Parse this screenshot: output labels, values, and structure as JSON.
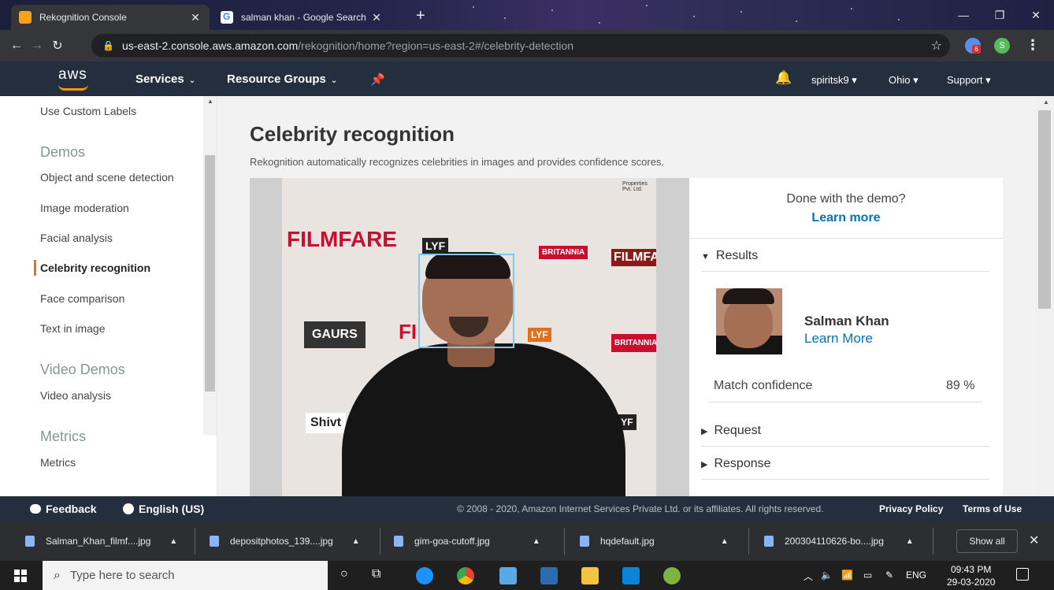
{
  "browser": {
    "tabs": [
      {
        "title": "Rekognition Console",
        "active": true
      },
      {
        "title": "salman khan - Google Search",
        "active": false
      }
    ],
    "new_tab": "+",
    "address": {
      "host": "us-east-2.console.aws.amazon.com",
      "path": "/rekognition/home?region=us-east-2#/celebrity-detection"
    },
    "ext_badge": "6",
    "profile_initial": "S",
    "window_controls": {
      "minimize": "—",
      "maximize": "❐",
      "close": "✕"
    }
  },
  "aws_nav": {
    "logo": "aws",
    "services": "Services",
    "resource_groups": "Resource Groups",
    "user": "spiritsk9",
    "region": "Ohio",
    "support": "Support"
  },
  "sidebar": {
    "top_item": "Use Custom Labels",
    "sections": [
      {
        "heading": "Demos",
        "items": [
          "Object and scene detection",
          "Image moderation",
          "Facial analysis",
          "Celebrity recognition",
          "Face comparison",
          "Text in image"
        ]
      },
      {
        "heading": "Video Demos",
        "items": [
          "Video analysis"
        ]
      },
      {
        "heading": "Metrics",
        "items": [
          "Metrics"
        ]
      }
    ],
    "active_item": "Celebrity recognition"
  },
  "main": {
    "title": "Celebrity recognition",
    "subtitle": "Rekognition automatically recognizes celebrities in images and provides confidence scores.",
    "photo_backdrop": {
      "filmfare_1": "FILMFARE",
      "lyf_1": "LYF",
      "britannia_1": "BRITANNIA",
      "filmfare_2": "FILMFARE",
      "gaurs": "GAURS",
      "fi": "FI",
      "lyf_2": "LYF",
      "britannia_2": "BRITANNIA",
      "shivt": "Shivt",
      "lyf_3": "LYF",
      "properties": "Properties Pvt. Ltd."
    },
    "results_panel": {
      "done_question": "Done with the demo?",
      "learn_more": "Learn more",
      "results_label": "Results",
      "celebrity_name": "Salman Khan",
      "celebrity_link": "Learn More",
      "match_confidence_label": "Match confidence",
      "match_confidence_value": "89 %",
      "request_label": "Request",
      "response_label": "Response"
    }
  },
  "footer": {
    "feedback": "Feedback",
    "language": "English (US)",
    "copyright": "© 2008 - 2020, Amazon Internet Services Private Ltd. or its affiliates. All rights reserved.",
    "privacy": "Privacy Policy",
    "terms": "Terms of Use"
  },
  "downloads": {
    "items": [
      "Salman_Khan_filmf....jpg",
      "depositphotos_139....jpg",
      "gim-goa-cutoff.jpg",
      "hqdefault.jpg",
      "200304110626-bo....jpg"
    ],
    "show_all": "Show all"
  },
  "taskbar": {
    "search_placeholder": "Type here to search",
    "lang": "ENG",
    "time": "09:43 PM",
    "date": "29-03-2020"
  },
  "colors": {
    "aws_nav": "#232f3e",
    "accent_orange": "#ec7211",
    "link_blue": "#0073bb",
    "bbox_blue": "#7ec8f2"
  }
}
